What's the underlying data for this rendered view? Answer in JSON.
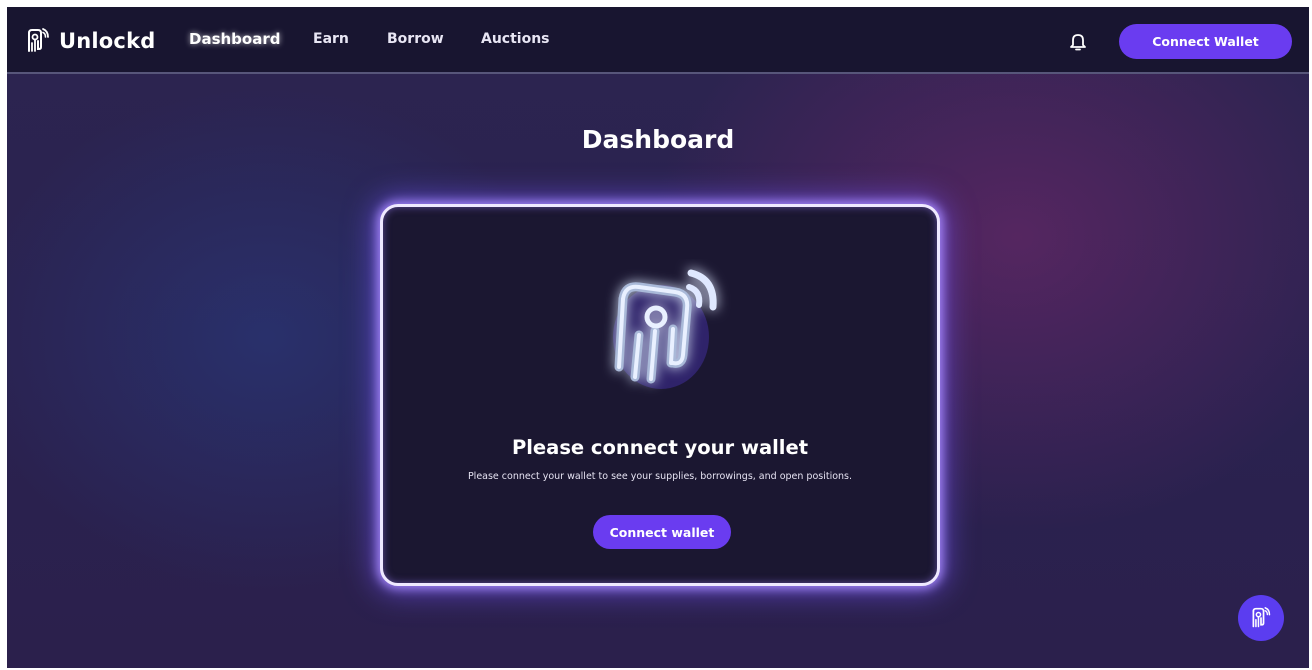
{
  "brand": {
    "name": "Unlockd",
    "logo_icon": "unlockd-logo-icon"
  },
  "nav": {
    "links": [
      "Dashboard",
      "Earn",
      "Borrow",
      "Auctions"
    ],
    "active": "Dashboard",
    "bell_icon": "bell-icon",
    "connect_label": "Connect Wallet"
  },
  "main": {
    "title": "Dashboard",
    "card": {
      "hero_icon": "unlockd-logo-icon",
      "title": "Please connect your wallet",
      "subtitle": "Please connect your wallet to see your supplies, borrowings, and open positions.",
      "button_label": "Connect wallet"
    }
  },
  "fab": {
    "icon": "unlockd-logo-icon"
  },
  "colors": {
    "accent": "#6a3cf0",
    "nav_bg": "#181530",
    "card_bg": "#1b1731",
    "page_bg": "#2a2250"
  }
}
